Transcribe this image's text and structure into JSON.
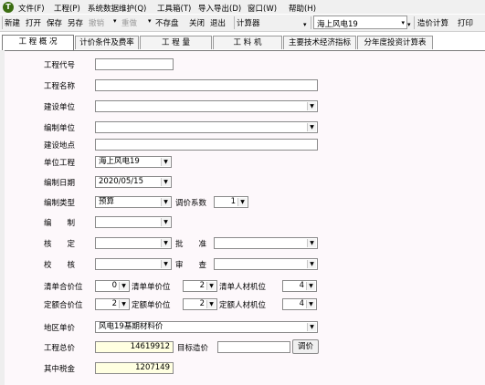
{
  "menubar": {
    "logo": "T",
    "items": [
      "文件(F)",
      "工程(P)",
      "系统数据维护(Q)",
      "工具箱(T)",
      "导入导出(D)",
      "窗口(W)",
      "帮助(H)"
    ]
  },
  "toolbar": {
    "new": "新建",
    "open": "打开",
    "save": "保存",
    "save_as": "另存",
    "undo": "撤销",
    "redo": "重做",
    "no_save": "不存盘",
    "close": "关闭",
    "exit": "退出",
    "calculator": "计算器",
    "project_select": "海上风电19",
    "cost_calc": "造价计算",
    "print": "打印"
  },
  "tabs": [
    "工 程 概 况",
    "计价条件及费率",
    "工 程 量",
    "工 料 机",
    "主要技术经济指标",
    "分年度投资计算表"
  ],
  "form": {
    "project_code": {
      "label": "工程代号",
      "value": ""
    },
    "project_name": {
      "label": "工程名称",
      "value": ""
    },
    "construction_unit": {
      "label": "建设单位",
      "value": ""
    },
    "compile_unit": {
      "label": "编制单位",
      "value": ""
    },
    "construction_site": {
      "label": "建设地点",
      "value": ""
    },
    "unit_project": {
      "label": "单位工程",
      "value": "海上风电19"
    },
    "compile_date": {
      "label": "编制日期",
      "value": "2020/05/15"
    },
    "compile_type": {
      "label": "编制类型",
      "value": "预算"
    },
    "price_coeff": {
      "label": "调价系数",
      "value": "1"
    },
    "compiler": {
      "label": "编　　制",
      "value": ""
    },
    "verify": {
      "label": "核　　定",
      "value": ""
    },
    "approve": {
      "label": "批　　准",
      "value": ""
    },
    "check": {
      "label": "校　　核",
      "value": ""
    },
    "review": {
      "label": "审　　查",
      "value": ""
    },
    "list_total_digits": {
      "label": "清单合价位",
      "value": "0"
    },
    "list_unit_digits": {
      "label": "清单单价位",
      "value": "2"
    },
    "list_lmm_digits": {
      "label": "清单人材机位",
      "value": "4"
    },
    "quota_total_digits": {
      "label": "定额合价位",
      "value": "2"
    },
    "quota_unit_digits": {
      "label": "定额单价位",
      "value": "2"
    },
    "quota_lmm_digits": {
      "label": "定额人材机位",
      "value": "4"
    },
    "region_price": {
      "label": "地区单价",
      "value": "风电19基期材料价"
    },
    "total_cost": {
      "label": "工程总价",
      "value": "14619912"
    },
    "target_cost": {
      "label": "目标造价",
      "value": ""
    },
    "adjust_button": "调价",
    "tax": {
      "label": "其中税金",
      "value": "1207149"
    }
  }
}
